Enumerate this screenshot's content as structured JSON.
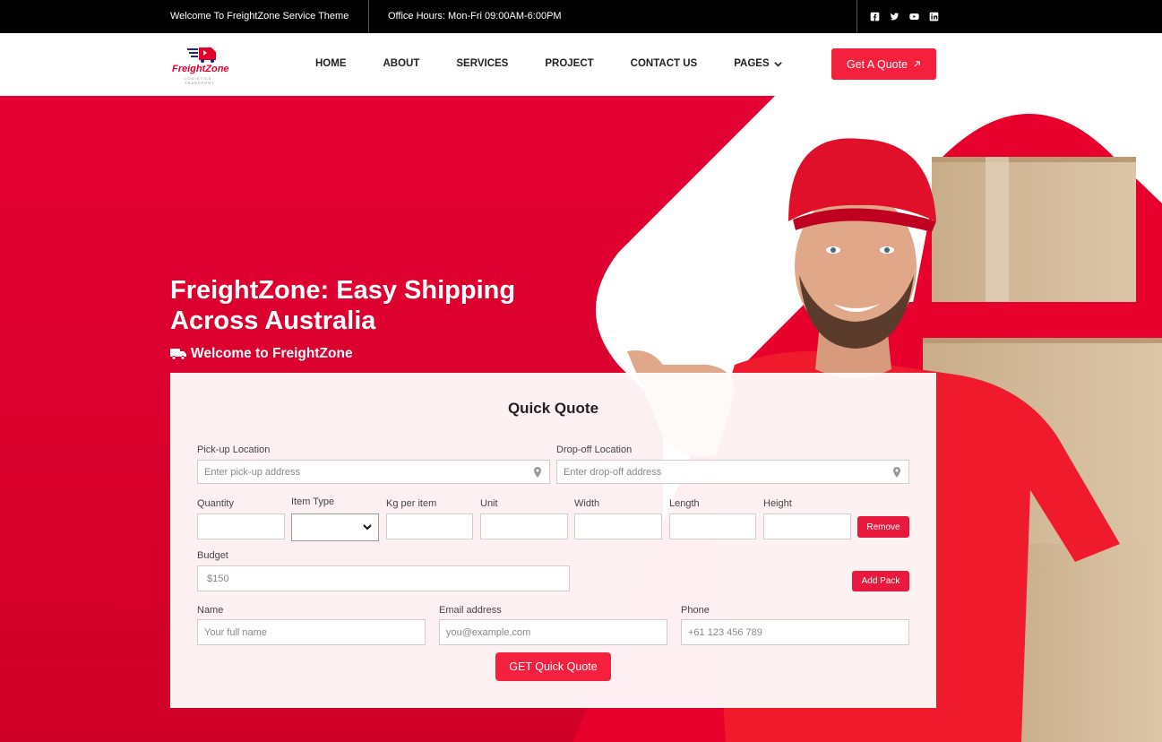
{
  "topbar": {
    "welcome": "Welcome To FreightZone Service Theme",
    "hours": "Office Hours: Mon-Fri 09:00AM-6:00PM",
    "socials": [
      "facebook-icon",
      "twitter-icon",
      "youtube-icon",
      "linkedin-icon"
    ]
  },
  "brand": {
    "name": "FreightZone",
    "tagline": "LOGISTICS · TRANSPORT",
    "accent": "#e4002b"
  },
  "nav": {
    "items": [
      {
        "label": "HOME"
      },
      {
        "label": "ABOUT"
      },
      {
        "label": "SERVICES"
      },
      {
        "label": "PROJECT"
      },
      {
        "label": "CONTACT US"
      },
      {
        "label": "PAGES"
      }
    ],
    "cta": "Get A Quote"
  },
  "hero": {
    "title": "FreightZone: Easy Shipping Across Australia",
    "subtitle": "Welcome to FreightZone"
  },
  "form": {
    "title": "Quick Quote",
    "pickup": {
      "label": "Pick-up Location",
      "placeholder": "Enter pick-up address"
    },
    "dropoff": {
      "label": "Drop-off Location",
      "placeholder": "Enter drop-off address"
    },
    "pack": {
      "quantity": "Quantity",
      "item_type": "Item Type",
      "kg": "Kg per item",
      "unit": "Unit",
      "width": "Width",
      "length": "Length",
      "height": "Height",
      "remove": "Remove"
    },
    "budget": {
      "label": "Budget",
      "placeholder": "$150"
    },
    "add_pack": "Add Pack",
    "name": {
      "label": "Name",
      "placeholder": "Your full name"
    },
    "email": {
      "label": "Email address",
      "placeholder": "you@example.com"
    },
    "phone": {
      "label": "Phone",
      "placeholder": "+61 123 456 789"
    },
    "submit": "GET Quick Quote"
  },
  "colors": {
    "primary": "#f5203e",
    "dark": "#000000"
  }
}
